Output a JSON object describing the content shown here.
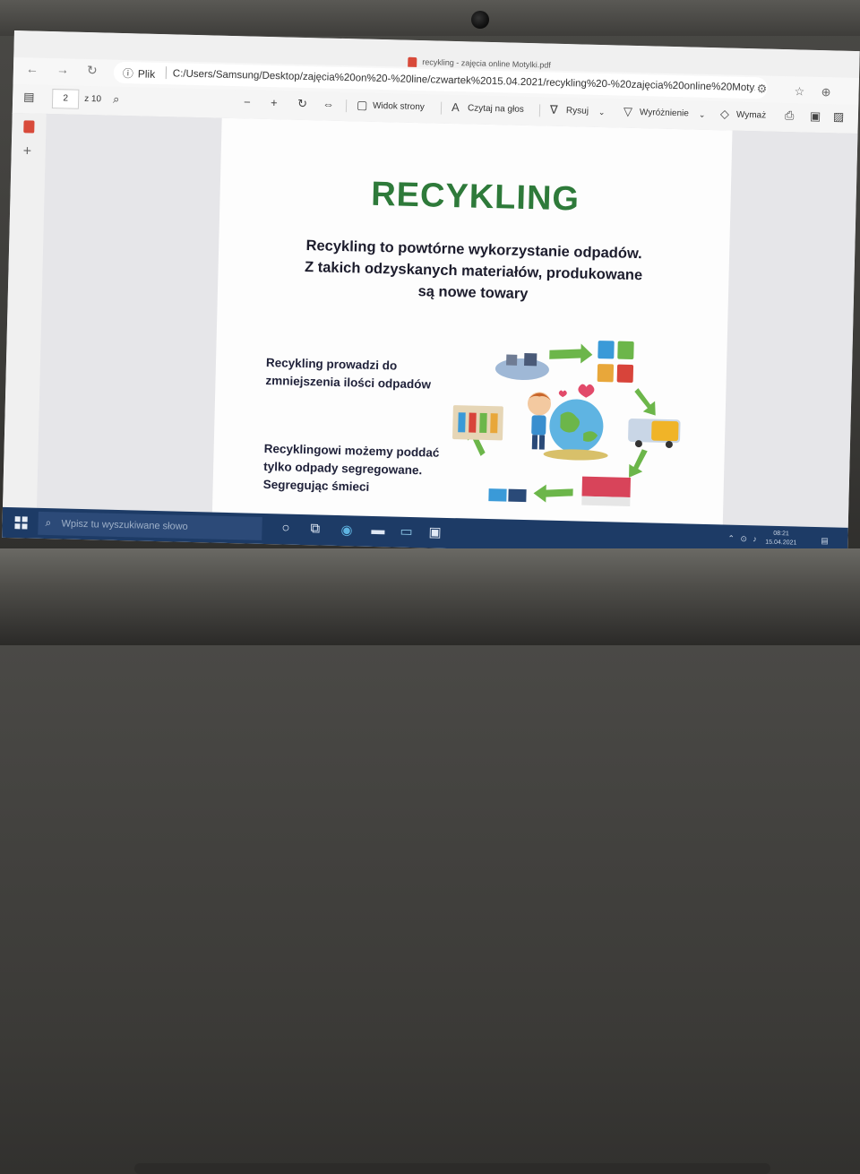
{
  "window": {
    "title": "recykling - zajęcia online Motylki.pdf"
  },
  "address_bar": {
    "scheme_label": "Plik",
    "url": "C:/Users/Samsung/Desktop/zajęcia%20on%20-%20line/czwartek%2015.04.2021/recykling%20-%20zajęcia%20online%20Moty..."
  },
  "pdf_toolbar": {
    "page_current": "2",
    "page_total": "z 10",
    "page_view_label": "Widok strony",
    "read_aloud_label": "Czytaj na głos",
    "draw_label": "Rysuj",
    "highlight_label": "Wyróżnienie",
    "erase_label": "Wymaż"
  },
  "document": {
    "heading": "RECYKLING",
    "subtitle_line1": "Recykling to powtórne wykorzystanie odpadów.",
    "subtitle_line2": "Z takich odzyskanych materiałów, produkowane",
    "subtitle_line3": "są nowe towary",
    "para1": "Recykling prowadzi do zmniejszenia ilości odpadów",
    "para2": "Recyklingowi możemy poddać tylko odpady segregowane. Segregując śmieci",
    "accent_color": "#2e7a3a"
  },
  "taskbar": {
    "search_placeholder": "Wpisz tu wyszukiwane słowo",
    "clock_time": "08:21",
    "clock_date": "15.04.2021"
  }
}
